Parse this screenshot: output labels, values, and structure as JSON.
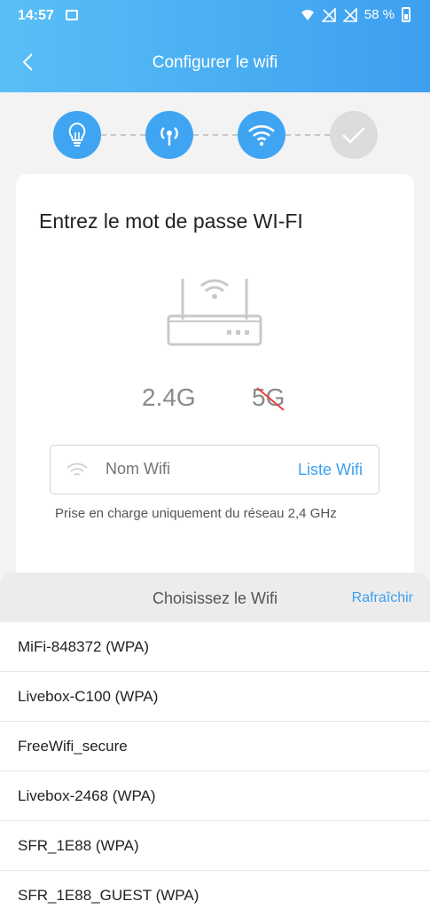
{
  "status": {
    "time": "14:57",
    "battery": "58 %",
    "icons": [
      "image-icon",
      "wifi-signal-icon",
      "no-sim-icon",
      "no-sim-icon",
      "battery-charging-icon"
    ]
  },
  "header": {
    "title": "Configurer le wifi",
    "back_icon": "chevron-left-icon"
  },
  "steps": [
    {
      "icon": "bulb-icon",
      "state": "active"
    },
    {
      "icon": "hotspot-icon",
      "state": "active"
    },
    {
      "icon": "wifi-icon",
      "state": "active"
    },
    {
      "icon": "check-icon",
      "state": "pending"
    }
  ],
  "card": {
    "title": "Entrez le mot de passe WI-FI",
    "band_24": "2.4G",
    "band_5": "5G",
    "wifi_placeholder": "Nom Wifi",
    "list_link": "Liste Wifi",
    "note": "Prise en charge uniquement du réseau 2,4 GHz"
  },
  "sheet": {
    "title": "Choisissez le Wifi",
    "refresh": "Rafraîchir",
    "networks": [
      "MiFi-848372  (WPA)",
      "Livebox-C100  (WPA)",
      "FreeWifi_secure",
      "Livebox-2468  (WPA)",
      "SFR_1E88  (WPA)",
      "SFR_1E88_GUEST  (WPA)"
    ]
  },
  "colors": {
    "accent": "#3d9ff0",
    "header_start": "#58bff6",
    "step_pending": "#dcdcdc",
    "strike": "#e8423a"
  }
}
